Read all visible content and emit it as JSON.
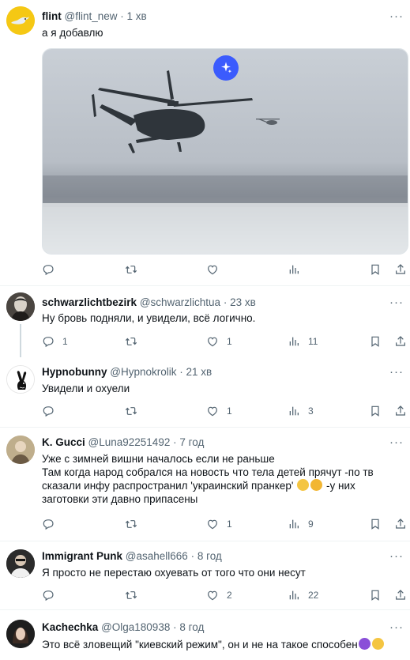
{
  "tweets": [
    {
      "name": "flint",
      "handle": "@flint_new",
      "sep": "·",
      "time": "1 хв",
      "text": "а я добавлю",
      "actions": {
        "reply": "",
        "retweet": "",
        "like": "",
        "views": ""
      }
    },
    {
      "name": "schwarzlichtbezirk",
      "handle": "@schwarzlichtua",
      "sep": "·",
      "time": "23 хв",
      "text": "Ну бровь подняли, и увидели, всё логично.",
      "actions": {
        "reply": "1",
        "retweet": "",
        "like": "1",
        "views": "11"
      }
    },
    {
      "name": "Hypnobunny",
      "handle": "@Hypnokrolik",
      "sep": "·",
      "time": "21 хв",
      "text": "Увидели и охуели",
      "actions": {
        "reply": "",
        "retweet": "",
        "like": "1",
        "views": "3"
      }
    },
    {
      "name": "K. Gucci",
      "handle": "@Luna92251492",
      "sep": "·",
      "time": "7 год",
      "text_lines": [
        "Уже с зимней вишни началось если не раньше",
        "Там когда народ собрался на новость что тела детей прячут -по тв",
        "сказали инфу распространил 'украинский пранкер'",
        "-у них",
        "заготовки эти давно припасены"
      ],
      "actions": {
        "reply": "",
        "retweet": "",
        "like": "1",
        "views": "9"
      }
    },
    {
      "name": "Immigrant Punk",
      "handle": "@asahell666",
      "sep": "·",
      "time": "8 год",
      "text": "Я просто не перестаю охуевать от того что они несут",
      "actions": {
        "reply": "",
        "retweet": "",
        "like": "2",
        "views": "22"
      }
    },
    {
      "name": "Kachechka",
      "handle": "@Olga180938",
      "sep": "·",
      "time": "8 год",
      "text": "Это всё зловещий \"киевский режим\", он и не на такое способен",
      "actions": {
        "reply": "",
        "retweet": "",
        "like": "",
        "views": ""
      }
    }
  ],
  "more_label": "···",
  "colors": {
    "text": "#0f1419",
    "secondary": "#536471",
    "border": "#eff3f4",
    "grok": "#3b5bfd"
  },
  "icons": [
    "reply-icon",
    "retweet-icon",
    "like-icon",
    "views-icon",
    "bookmark-icon",
    "share-icon",
    "grok-icon"
  ]
}
